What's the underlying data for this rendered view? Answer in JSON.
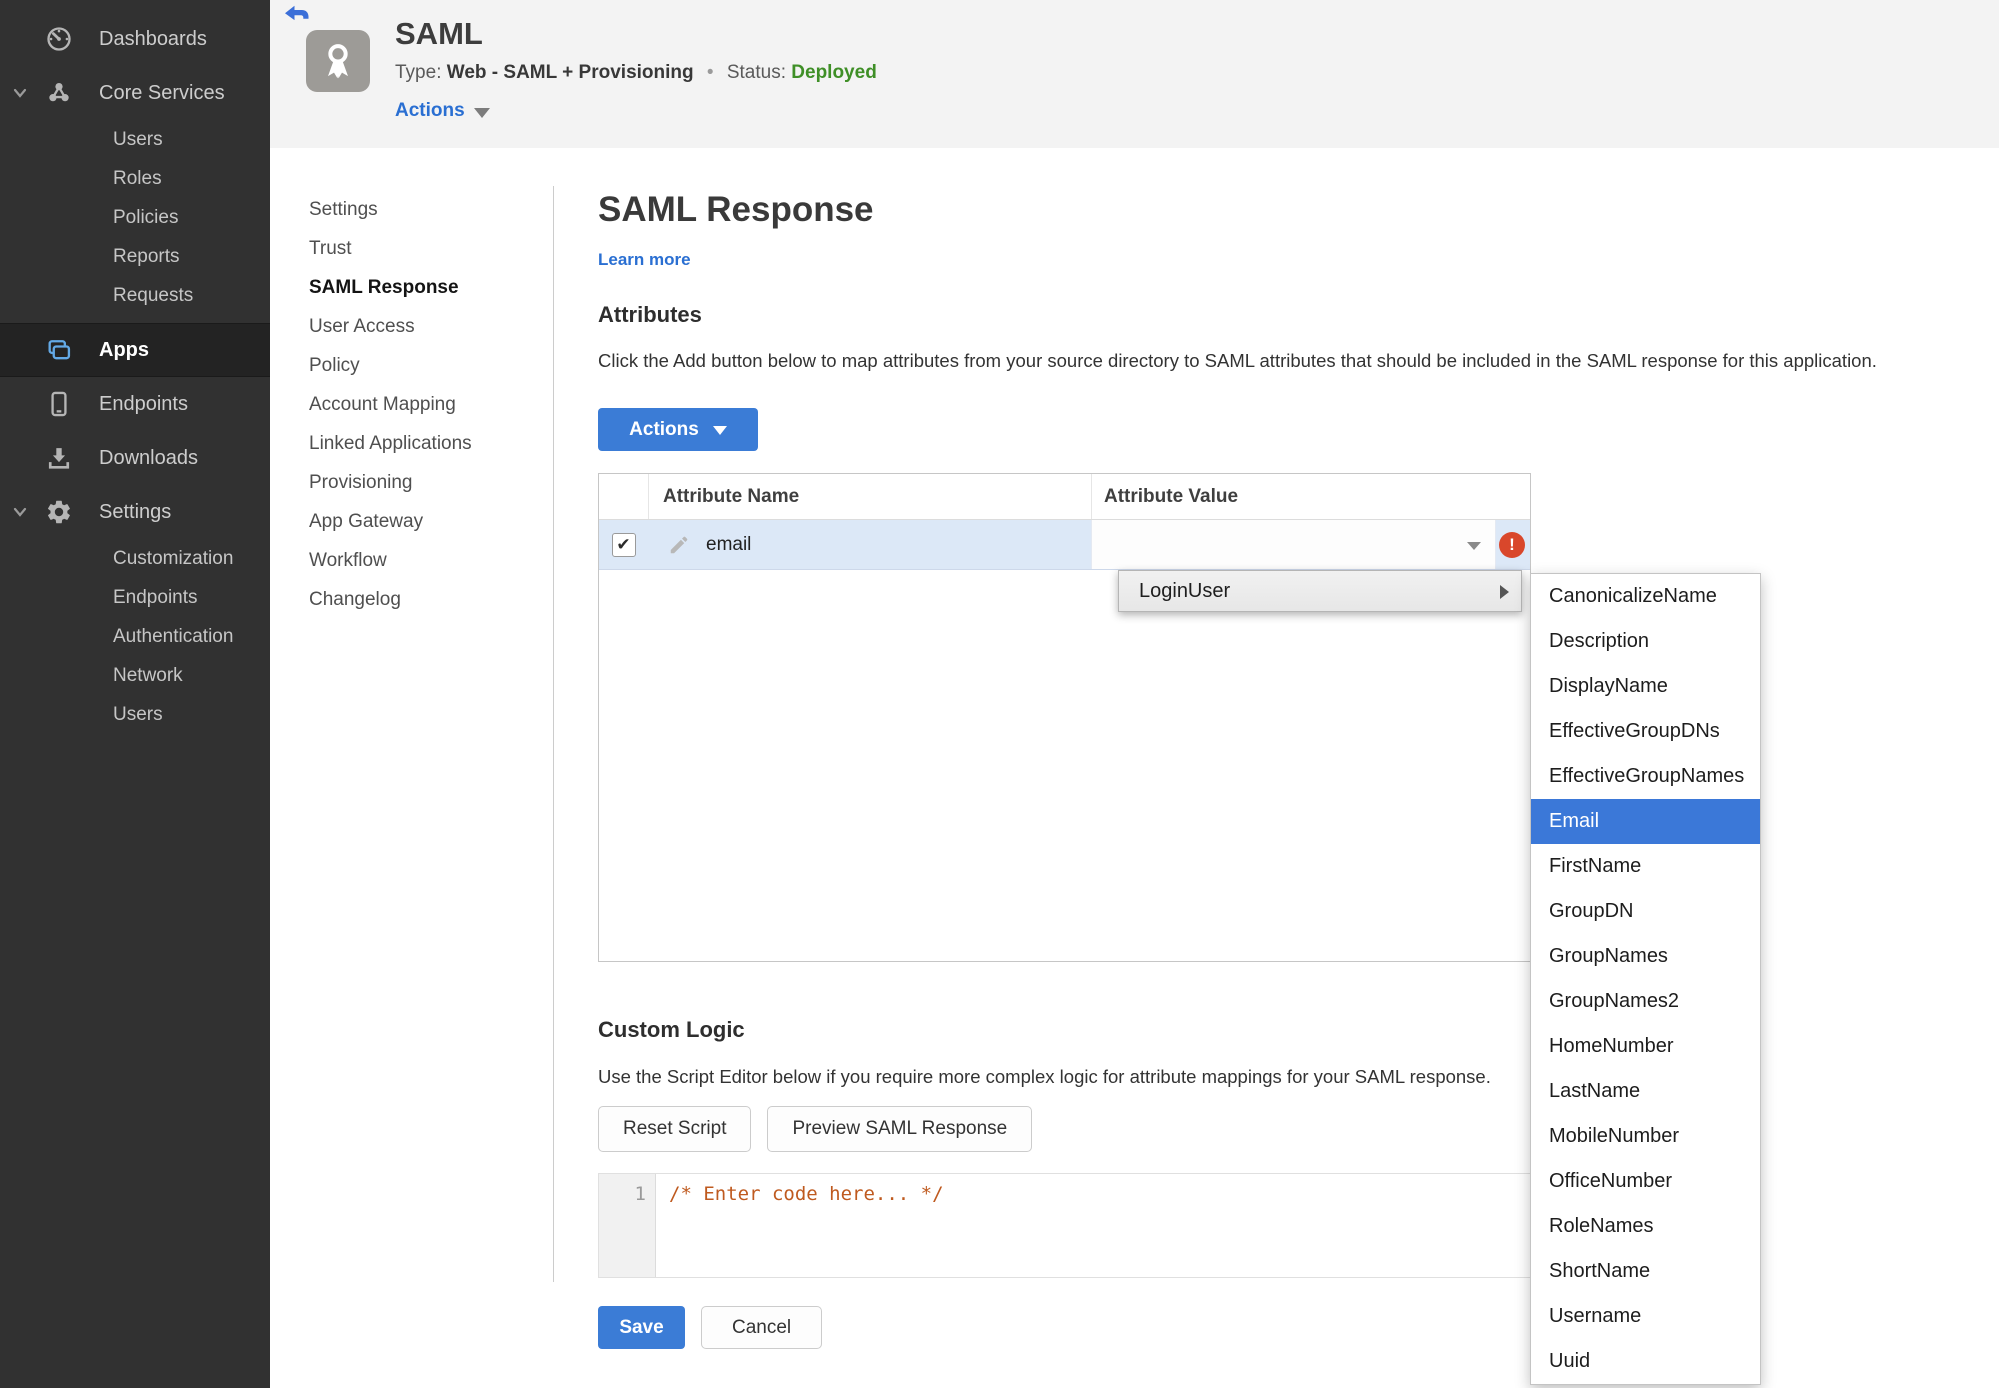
{
  "colors": {
    "accent_blue": "#3b7cd6",
    "link_blue": "#2a6fd2",
    "status_green": "#3f8f27",
    "error_red": "#d9472b",
    "sidebar_bg": "#313131",
    "selection_blue": "#3b78d8",
    "row_highlight": "#dce8f7"
  },
  "sidebar": {
    "items": [
      {
        "label": "Dashboards",
        "icon": "dashboard-gauge-icon",
        "type": "top"
      },
      {
        "label": "Core Services",
        "icon": "core-services-icon",
        "type": "group",
        "expanded": true
      },
      {
        "label": "Users",
        "type": "sub"
      },
      {
        "label": "Roles",
        "type": "sub"
      },
      {
        "label": "Policies",
        "type": "sub"
      },
      {
        "label": "Reports",
        "type": "sub"
      },
      {
        "label": "Requests",
        "type": "sub"
      },
      {
        "label": "Apps",
        "icon": "apps-icon",
        "type": "top",
        "active": true
      },
      {
        "label": "Endpoints",
        "icon": "endpoints-phone-icon",
        "type": "top"
      },
      {
        "label": "Downloads",
        "icon": "downloads-icon",
        "type": "top"
      },
      {
        "label": "Settings",
        "icon": "settings-gear-icon",
        "type": "group",
        "expanded": true
      },
      {
        "label": "Customization",
        "type": "sub"
      },
      {
        "label": "Endpoints",
        "type": "sub"
      },
      {
        "label": "Authentication",
        "type": "sub"
      },
      {
        "label": "Network",
        "type": "sub"
      },
      {
        "label": "Users",
        "type": "sub"
      }
    ]
  },
  "topbar": {
    "back_icon": "back-arrow-icon",
    "app_icon": "award-ribbon-icon",
    "title": "SAML",
    "type_label": "Type:",
    "type_value": "Web - SAML + Provisioning",
    "dot": "•",
    "status_label": "Status:",
    "status_value": "Deployed",
    "actions_label": "Actions"
  },
  "subnav": {
    "items": [
      {
        "label": "Settings"
      },
      {
        "label": "Trust"
      },
      {
        "label": "SAML Response",
        "active": true
      },
      {
        "label": "User Access"
      },
      {
        "label": "Policy"
      },
      {
        "label": "Account Mapping"
      },
      {
        "label": "Linked Applications"
      },
      {
        "label": "Provisioning"
      },
      {
        "label": "App Gateway"
      },
      {
        "label": "Workflow"
      },
      {
        "label": "Changelog"
      }
    ]
  },
  "main": {
    "title": "SAML Response",
    "learn_more": "Learn more",
    "attributes_heading": "Attributes",
    "attributes_description": "Click the Add button below to map attributes from your source directory to SAML attributes that should be included in the SAML response for this application.",
    "actions_button": "Actions",
    "table": {
      "columns": [
        "Attribute Name",
        "Attribute Value"
      ],
      "rows": [
        {
          "name": "email",
          "value": "",
          "checked": true,
          "error": true,
          "error_mark": "!",
          "check_mark": "✔"
        }
      ]
    },
    "custom_logic_heading": "Custom Logic",
    "custom_logic_description": "Use the Script Editor below if you require more complex logic for attribute mappings for your SAML response.",
    "reset_button": "Reset Script",
    "preview_button": "Preview SAML Response",
    "editor": {
      "line_number": "1",
      "code": "/* Enter code here... */"
    },
    "save_button": "Save",
    "cancel_button": "Cancel"
  },
  "value_dropdown": {
    "menu_label": "LoginUser",
    "options": [
      {
        "label": "CanonicalizeName"
      },
      {
        "label": "Description"
      },
      {
        "label": "DisplayName"
      },
      {
        "label": "EffectiveGroupDNs"
      },
      {
        "label": "EffectiveGroupNames"
      },
      {
        "label": "Email",
        "selected": true
      },
      {
        "label": "FirstName"
      },
      {
        "label": "GroupDN"
      },
      {
        "label": "GroupNames"
      },
      {
        "label": "GroupNames2"
      },
      {
        "label": "HomeNumber"
      },
      {
        "label": "LastName"
      },
      {
        "label": "MobileNumber"
      },
      {
        "label": "OfficeNumber"
      },
      {
        "label": "RoleNames"
      },
      {
        "label": "ShortName"
      },
      {
        "label": "Username"
      },
      {
        "label": "Uuid"
      }
    ]
  }
}
